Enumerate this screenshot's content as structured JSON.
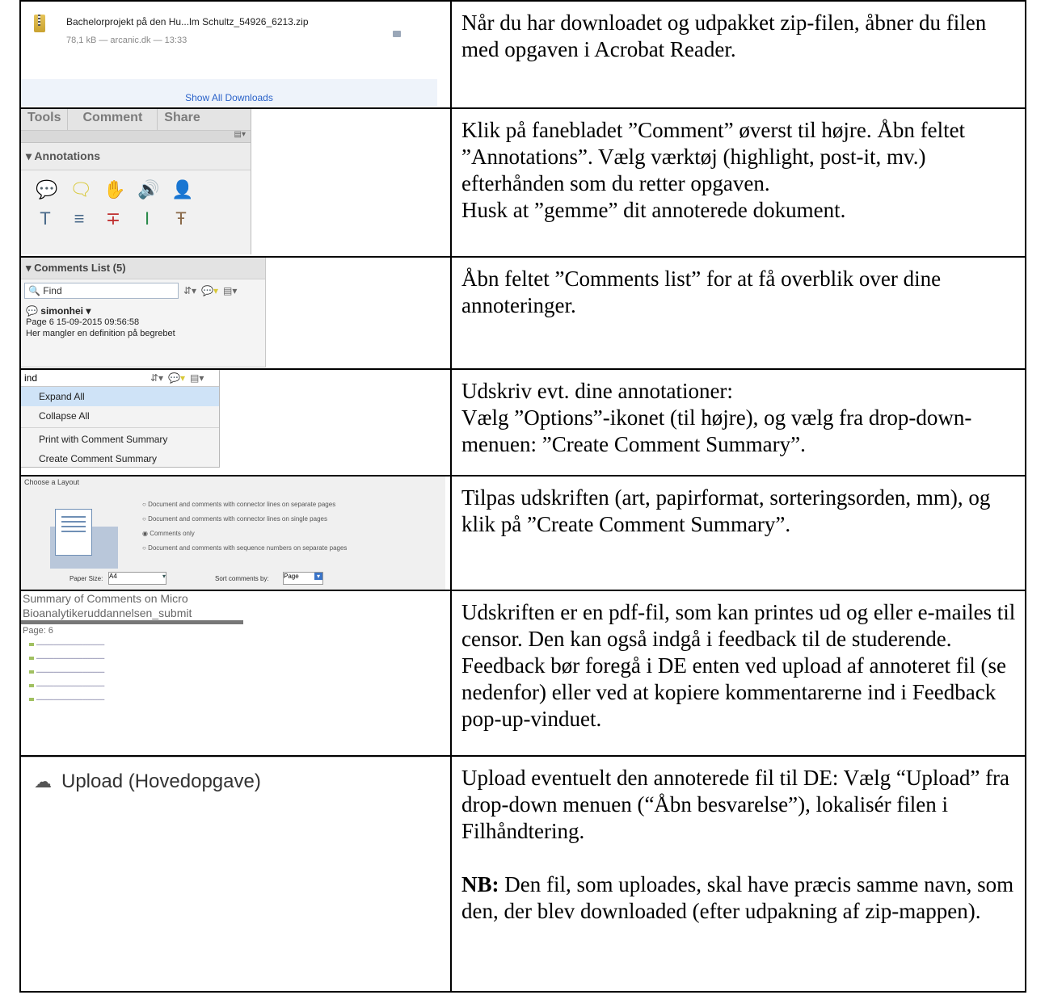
{
  "rows": [
    {
      "screenshot": {
        "file_name": "Bachelorprojekt på den Hu...lm Schultz_54926_6213.zip",
        "file_meta": "78,1 kB — arcanic.dk — 13:33",
        "show_all": "Show All Downloads"
      },
      "text": [
        "Når du har downloadet og udpakket zip-filen, åbner du filen med opgaven i Acrobat Reader."
      ]
    },
    {
      "screenshot": {
        "tabs": [
          "Tools",
          "Comment",
          "Share"
        ],
        "section": "Annotations"
      },
      "text": [
        "Klik på fanebladet ”Comment” øverst til højre. Åbn feltet ”Annotations”. Vælg værktøj (highlight, post-it, mv.) efterhånden som du retter opgaven.",
        "Husk at ”gemme” dit annoterede dokument."
      ]
    },
    {
      "screenshot": {
        "header": "Comments List (5)",
        "find": "Find",
        "user": "simonhei",
        "meta": "Page 6  15-09-2015 09:56:58",
        "comment": "Her mangler en definition på begrebet"
      },
      "text": [
        "Åbn feltet ”Comments list” for at få overblik over dine annoteringer."
      ]
    },
    {
      "screenshot": {
        "search": "ind",
        "items": [
          "Expand All",
          "Collapse All",
          "Print with Comment Summary",
          "Create Comment Summary"
        ]
      },
      "text": [
        "Udskriv evt. dine annotationer:",
        "Vælg ”Options”-ikonet (til højre), og vælg fra drop-down-menuen: ”Create Comment Summary”."
      ]
    },
    {
      "screenshot": {
        "title": "Choose a Layout",
        "options": [
          "Document and comments with connector lines on separate pages",
          "Document and comments with connector lines on single pages",
          "Comments only",
          "Document and comments with sequence numbers on separate pages"
        ],
        "paper_label": "Paper Size:",
        "paper_value": "A4",
        "sort_label": "Sort comments by:",
        "sort_value": "Page"
      },
      "text": [
        "Tilpas udskriften (art, papirformat, sorteringsorden, mm), og klik på ”Create Comment Summary”."
      ]
    },
    {
      "screenshot": {
        "title_line1": "Summary of Comments on Micro",
        "title_line2": "Bioanalytikeruddannelsen_submit",
        "page": "Page: 6"
      },
      "text": [
        "Udskriften er en pdf-fil, som kan printes ud og eller e-mailes til censor. Den kan også indgå i feedback til de studerende. Feedback bør foregå i DE enten ved upload af annoteret fil (se nedenfor) eller ved at kopiere kommentarerne ind i Feedback pop-up-vinduet."
      ]
    },
    {
      "screenshot": {
        "upload_label": "Upload (Hovedopgave)"
      },
      "text": [
        "Upload eventuelt den annoterede fil til DE: Vælg “Upload” fra drop-down menuen (“Åbn besvarelse”), lokalisér filen i Filhåndtering."
      ],
      "note_bold": "NB:",
      "note_text": " Den fil, som uploades, skal have præcis samme navn, som den, der blev downloaded (efter udpakning af zip-mappen)."
    }
  ]
}
